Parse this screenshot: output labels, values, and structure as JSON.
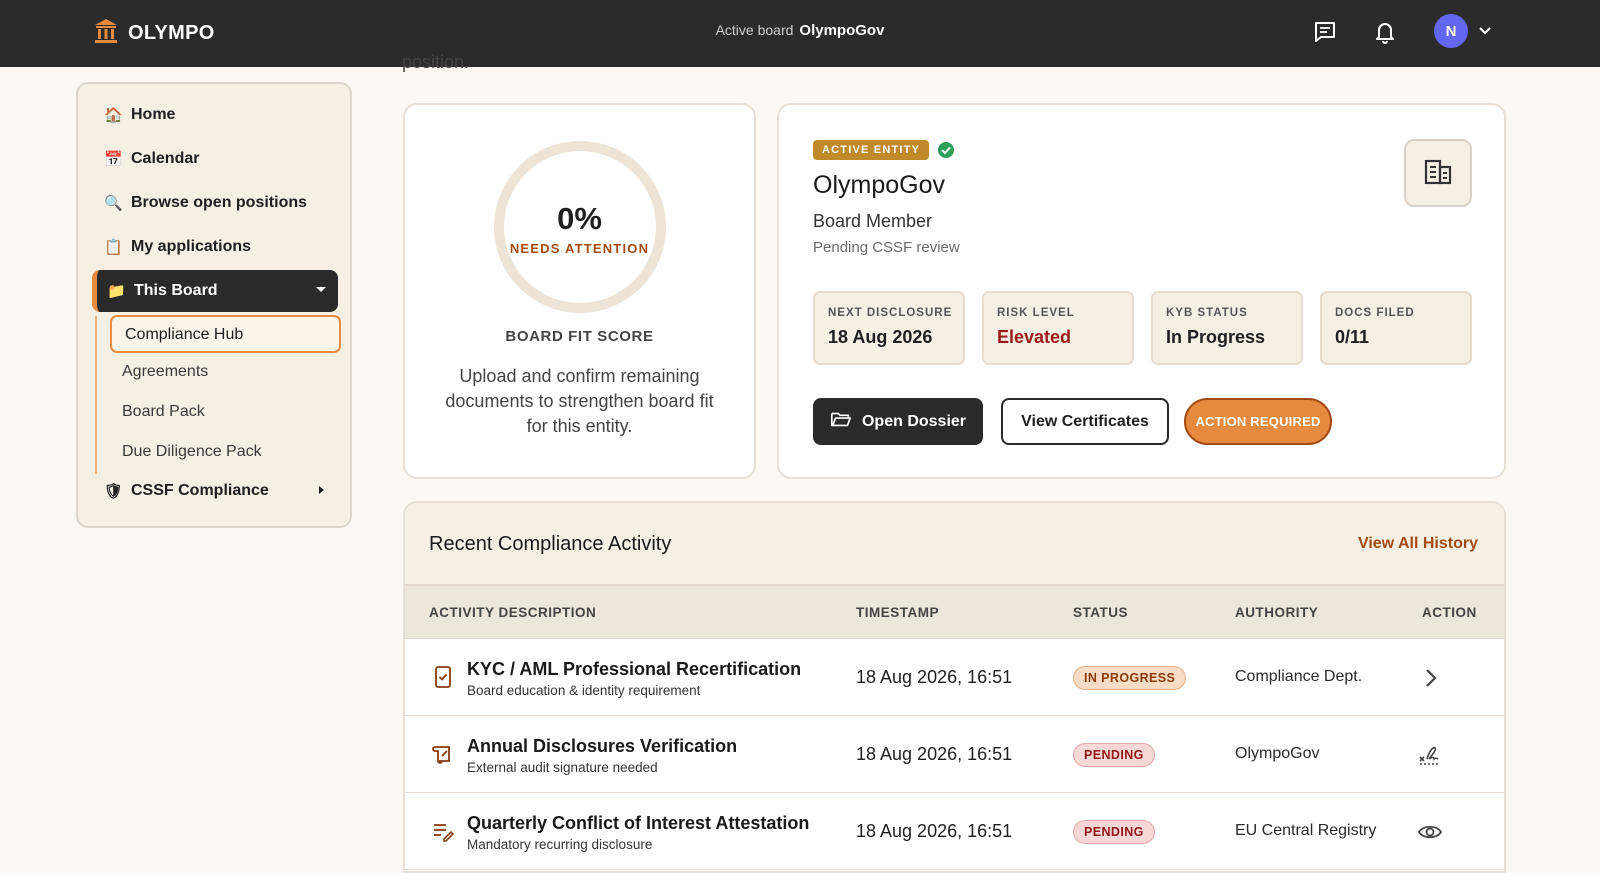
{
  "header": {
    "logo_text": "OLYMPO",
    "active_board_label": "Active board",
    "active_board_value": "OlympoGov",
    "avatar_initial": "N",
    "icons": [
      "building-columns-icon",
      "chat-icon",
      "bell-icon",
      "chevron-down-icon"
    ],
    "avatar_color": "#6366f1"
  },
  "sidebar": {
    "items": [
      {
        "icon": "🏠",
        "label": "Home"
      },
      {
        "icon": "📅",
        "label": "Calendar"
      },
      {
        "icon": "🔍",
        "label": "Browse open positions"
      },
      {
        "icon": "📋",
        "label": "My applications"
      },
      {
        "icon": "📁",
        "label": "This Board"
      },
      {
        "icon": "🛡",
        "label": "CSSF Compliance"
      }
    ],
    "sub_items": [
      "Compliance Hub",
      "Agreements",
      "Board Pack",
      "Due Diligence Pack"
    ]
  },
  "main": {
    "cut_text": "position."
  },
  "score": {
    "value": "0%",
    "status": "NEEDS ATTENTION",
    "title": "BOARD FIT SCORE",
    "description": "Upload and confirm remaining documents to strengthen board fit for this entity.",
    "fill_percent": 0
  },
  "entity": {
    "badge": "ACTIVE ENTITY",
    "name": "OlympoGov",
    "role": "Board Member",
    "status": "Pending CSSF review",
    "stats": [
      {
        "label": "NEXT DISCLOSURE",
        "value": "18 Aug 2026"
      },
      {
        "label": "RISK LEVEL",
        "value": "Elevated"
      },
      {
        "label": "KYB STATUS",
        "value": "In Progress"
      },
      {
        "label": "DOCS FILED",
        "value": "0/11"
      }
    ],
    "buttons": {
      "open_dossier": "Open Dossier",
      "view_certificates": "View Certificates",
      "action_required": "ACTION REQUIRED"
    },
    "accent_color": "#e58a3e",
    "badge_color": "#c08a2c"
  },
  "activity": {
    "title": "Recent Compliance Activity",
    "view_all": "View All History",
    "columns": [
      "ACTIVITY DESCRIPTION",
      "TIMESTAMP",
      "STATUS",
      "AUTHORITY",
      "ACTION"
    ],
    "rows": [
      {
        "icon": "phone-check-icon",
        "title": "KYC / AML Professional Recertification",
        "subtitle": "Board education & identity requirement",
        "timestamp": "18 Aug 2026, 16:51",
        "status": "IN PROGRESS",
        "authority": "Compliance Dept.",
        "action": "chevron-right-icon"
      },
      {
        "icon": "scroll-icon",
        "title": "Annual Disclosures Verification",
        "subtitle": "External audit signature needed",
        "timestamp": "18 Aug 2026, 16:51",
        "status": "PENDING",
        "authority": "OlympoGov",
        "action": "signature-icon"
      },
      {
        "icon": "list-edit-icon",
        "title": "Quarterly Conflict of Interest Attestation",
        "subtitle": "Mandatory recurring disclosure",
        "timestamp": "18 Aug 2026, 16:51",
        "status": "PENDING",
        "authority": "EU Central Registry",
        "action": "eye-icon"
      }
    ]
  }
}
